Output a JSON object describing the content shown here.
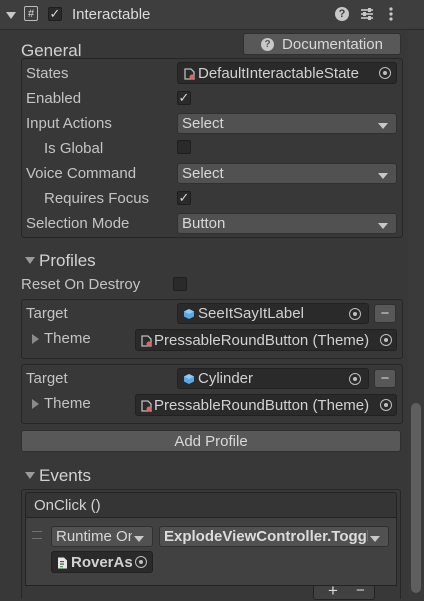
{
  "header": {
    "component_title": "Interactable"
  },
  "general": {
    "section_title": "General",
    "documentation_label": "Documentation",
    "states_label": "States",
    "states_value": "DefaultInteractableState",
    "enabled_label": "Enabled",
    "input_actions_label": "Input Actions",
    "input_actions_value": "Select",
    "is_global_label": "Is Global",
    "voice_command_label": "Voice Command",
    "voice_command_value": "Select",
    "requires_focus_label": "Requires Focus",
    "selection_mode_label": "Selection Mode",
    "selection_mode_value": "Button"
  },
  "profiles": {
    "section_title": "Profiles",
    "reset_on_destroy_label": "Reset On Destroy",
    "items": [
      {
        "target_label": "Target",
        "target_value": "SeeItSayItLabel",
        "theme_label": "Theme",
        "theme_value": "PressableRoundButton (Theme)",
        "remove_label": "−"
      },
      {
        "target_label": "Target",
        "target_value": "Cylinder",
        "theme_label": "Theme",
        "theme_value": "PressableRoundButton (Theme)",
        "remove_label": "−"
      }
    ],
    "add_profile_label": "Add Profile"
  },
  "events": {
    "section_title": "Events",
    "onclick_title": "OnClick ()",
    "runtime_value": "Runtime Only",
    "function_value": "ExplodeViewController.ToggleExplodedView",
    "object_value": "RoverAssembly",
    "add_label": "+",
    "remove_label": "−"
  }
}
